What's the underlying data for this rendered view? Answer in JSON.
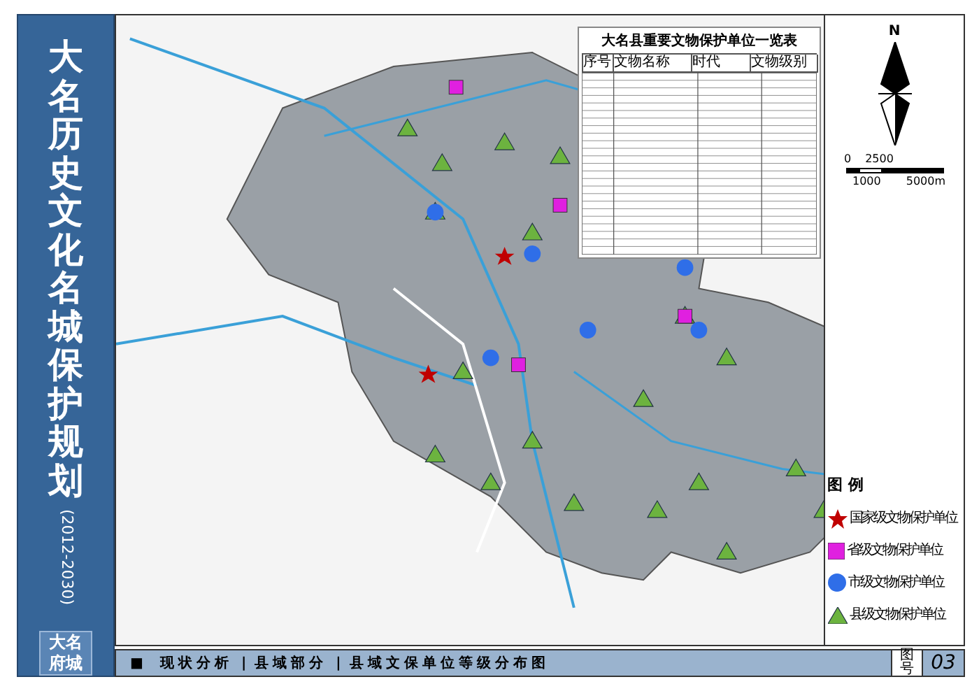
{
  "title": "大名历史文化名城保护规划",
  "years": "(2012-2030)",
  "logo": [
    "大名",
    "府城"
  ],
  "table": {
    "title": "大名县重要文物保护单位一览表",
    "columns": [
      "序号",
      "文物名称",
      "时代",
      "文物级别"
    ]
  },
  "compass": {
    "north": "N",
    "scale": [
      "0",
      "2500",
      "1000",
      "5000m"
    ]
  },
  "legend": {
    "title": "图 例",
    "items": [
      {
        "kind": "star",
        "color": "#c00000",
        "label": "国家级文物保护单位"
      },
      {
        "kind": "square",
        "color": "#e020e0",
        "label": "省级文物保护单位"
      },
      {
        "kind": "circle",
        "color": "#2f6ee8",
        "label": "市级文物保护单位"
      },
      {
        "kind": "triangle",
        "color": "#6cb33f",
        "label": "县级文物保护单位"
      }
    ]
  },
  "footer": {
    "marker": "■",
    "sections": [
      "现状分析",
      "县域部分",
      "县域文保单位等级分布图"
    ],
    "separator": "|",
    "number_label": "图号",
    "number": "03"
  }
}
